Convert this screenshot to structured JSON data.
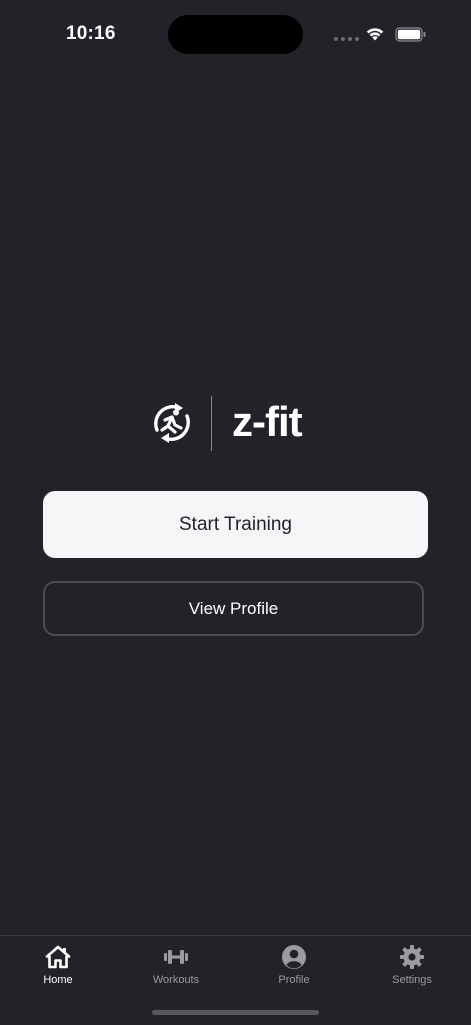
{
  "status_bar": {
    "time": "10:16"
  },
  "logo": {
    "text": "z-fit",
    "icon": "running-person-cycle-icon"
  },
  "actions": {
    "start_training": "Start Training",
    "view_profile": "View Profile"
  },
  "tab_bar": {
    "items": [
      {
        "label": "Home",
        "icon": "home-icon",
        "active": true
      },
      {
        "label": "Workouts",
        "icon": "dumbbell-icon",
        "active": false
      },
      {
        "label": "Profile",
        "icon": "person-circle-icon",
        "active": false
      },
      {
        "label": "Settings",
        "icon": "gear-icon",
        "active": false
      }
    ]
  },
  "colors": {
    "background": "#212329",
    "primary_button": "#f5f6f8",
    "active_tab": "#ffffff",
    "inactive_tab": "#9a9ca1"
  }
}
